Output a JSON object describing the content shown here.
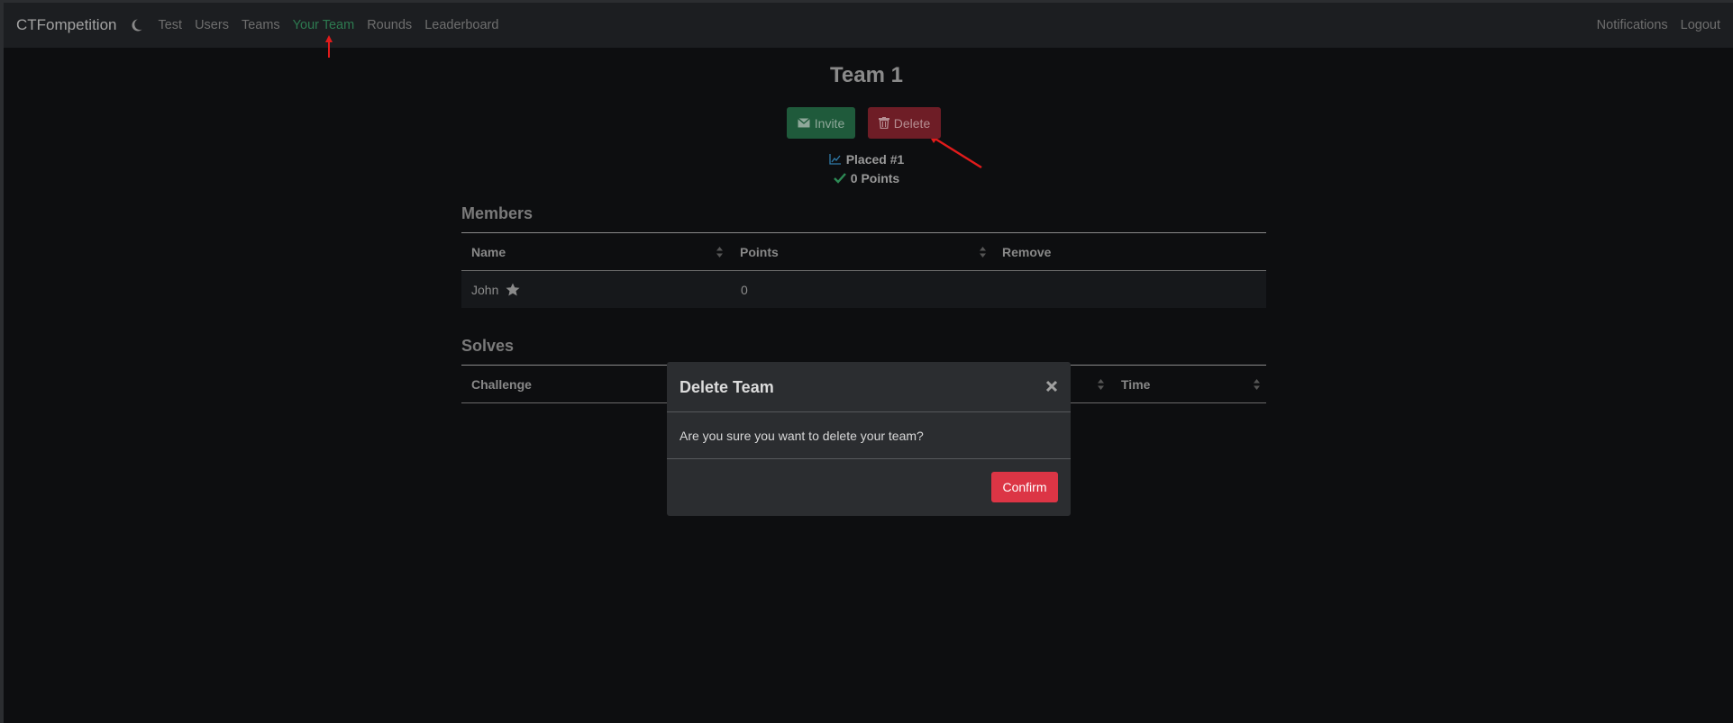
{
  "navbar": {
    "brand": "CTFompetition",
    "links": [
      {
        "label": "Test",
        "active": false
      },
      {
        "label": "Users",
        "active": false
      },
      {
        "label": "Teams",
        "active": false
      },
      {
        "label": "Your Team",
        "active": true
      },
      {
        "label": "Rounds",
        "active": false
      },
      {
        "label": "Leaderboard",
        "active": false
      }
    ],
    "right_links": [
      "Notifications",
      "Logout"
    ]
  },
  "team": {
    "title": "Team 1",
    "invite_label": "Invite",
    "delete_label": "Delete",
    "placed": "Placed #1",
    "points": "0 Points"
  },
  "members": {
    "title": "Members",
    "columns": [
      "Name",
      "Points",
      "Remove"
    ],
    "rows": [
      {
        "name": "John",
        "points": "0",
        "captain": true
      }
    ]
  },
  "solves": {
    "title": "Solves",
    "columns": [
      "Challenge",
      "Time"
    ]
  },
  "modal": {
    "title": "Delete Team",
    "body": "Are you sure you want to delete your team?",
    "confirm_label": "Confirm"
  },
  "colors": {
    "accent_green": "#2d7a50",
    "danger": "#dc3545",
    "annotation_red": "#e11b1b"
  }
}
